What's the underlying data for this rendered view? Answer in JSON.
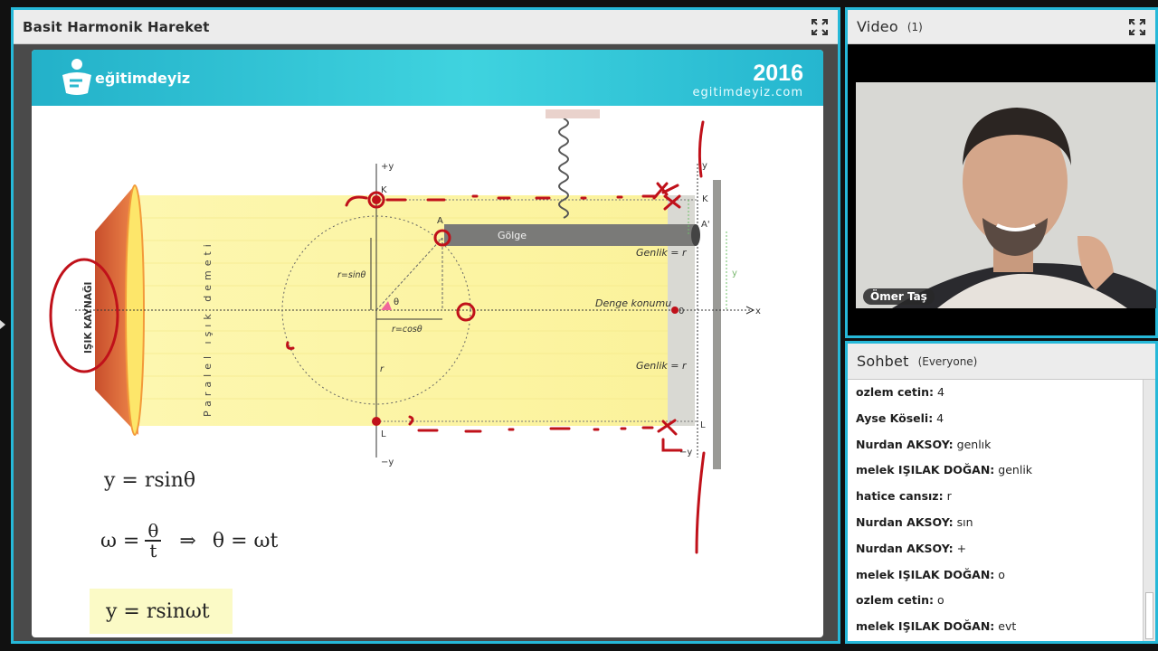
{
  "share_pod": {
    "title": "Basit Harmonik Hareket"
  },
  "slide": {
    "logo": "eğitimdeyiz",
    "year": "2016",
    "site": "egitimdeyiz.com",
    "diagram_labels": {
      "light_source": "IŞIK KAYNAĞI",
      "beam": "Paralel ışık demeti",
      "shadow": "Gölge",
      "plus_y": "+y",
      "minus_y": "−y",
      "k_top": "K",
      "l_bottom": "L",
      "a_point": "A",
      "r_sin": "r=sinθ",
      "r_cos": "r=cosθ",
      "theta": "θ",
      "r": "r",
      "amp_top": "Genlik = r",
      "equilibrium": "Denge konumu",
      "zero": "0",
      "amp_bottom": "Genlik = r",
      "y_axis": "y",
      "x_axis": "x",
      "k_right": "K",
      "a_prime": "A'",
      "l_right": "L",
      "y_small": "y",
      "neg_y_right": "−y"
    },
    "formula1": "y = rsinθ",
    "formula2_lhs": "ω =",
    "formula2_num": "θ",
    "formula2_den": "t",
    "formula2_arrow": "⇒",
    "formula2_rhs": "θ = ωt",
    "formula3": "y = rsinωt"
  },
  "video_pod": {
    "title": "Video",
    "count": "(1)",
    "presenter": "Ömer Taş"
  },
  "chat_pod": {
    "title": "Sohbet",
    "scope": "(Everyone)",
    "messages": [
      {
        "name": "ozlem cetin:",
        "text": "4"
      },
      {
        "name": "Ayse Köseli:",
        "text": "4"
      },
      {
        "name": "Nurdan AKSOY:",
        "text": "genlık"
      },
      {
        "name": "melek IŞILAK DOĞAN:",
        "text": "genlik"
      },
      {
        "name": "hatice cansız:",
        "text": "r"
      },
      {
        "name": "Nurdan AKSOY:",
        "text": "sın"
      },
      {
        "name": "Nurdan AKSOY:",
        "text": "+"
      },
      {
        "name": "melek IŞILAK DOĞAN:",
        "text": "o"
      },
      {
        "name": "ozlem cetin:",
        "text": "o"
      },
      {
        "name": "melek IŞILAK DOĞAN:",
        "text": "evt"
      }
    ]
  },
  "colors": {
    "accent": "#26b8d8",
    "annotation_red": "#c0111a",
    "beam_yellow": "#fbf6a8"
  }
}
